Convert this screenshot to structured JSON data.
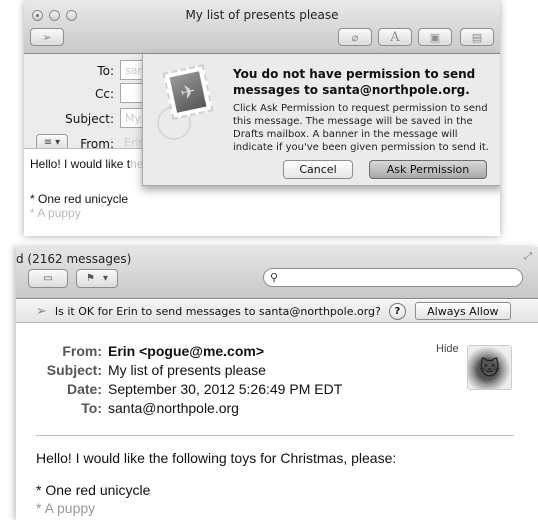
{
  "compose": {
    "title": "My list of presents please",
    "toolbar": {
      "send_icon": "paper-plane-icon",
      "attach_icon": "paperclip-icon",
      "fonts_icon": "fonts-icon",
      "photo_icon": "photo-browser-icon",
      "stationery_icon": "stationery-icon"
    },
    "headers": {
      "to_label": "To:",
      "to_value": "santa@northpole.org",
      "cc_label": "Cc:",
      "cc_value": "",
      "subject_label": "Subject:",
      "subject_value": "My list of presents please",
      "from_label": "From:",
      "from_value": "Erin <pogue@me.com>",
      "format_menu": "≡ ▾"
    },
    "body": {
      "line1_visible": "Hello! I would like t",
      "line1_faded": "he following toys for Christmas, please",
      "line2": "* One red unicycle",
      "line3": "* A puppy"
    }
  },
  "sheet": {
    "title": "You do not have permission to send messages to santa@northpole.org.",
    "message": "Click Ask Permission to request permission to send this message. The message will be saved in the Drafts mailbox. A banner in the message will indicate if you've been given permission to send it.",
    "cancel_label": "Cancel",
    "ask_label": "Ask Permission"
  },
  "viewer": {
    "title": "d (2162 messages)",
    "search_placeholder": "",
    "banner": {
      "text": "Is it OK for Erin to send messages to santa@northpole.org?",
      "help_label": "?",
      "allow_label": "Always Allow"
    },
    "headers": [
      {
        "label": "From:",
        "value": "Erin <pogue@me.com>"
      },
      {
        "label": "Subject:",
        "value": "My list of presents please"
      },
      {
        "label": "Date:",
        "value": "September 30, 2012 5:26:49 PM EDT"
      },
      {
        "label": "To:",
        "value": "santa@northpole.org"
      }
    ],
    "hide_label": "Hide",
    "body": {
      "line1": "Hello! I would like the following toys for Christmas, please:",
      "line2": "* One red unicycle",
      "line3": "* A puppy"
    }
  }
}
